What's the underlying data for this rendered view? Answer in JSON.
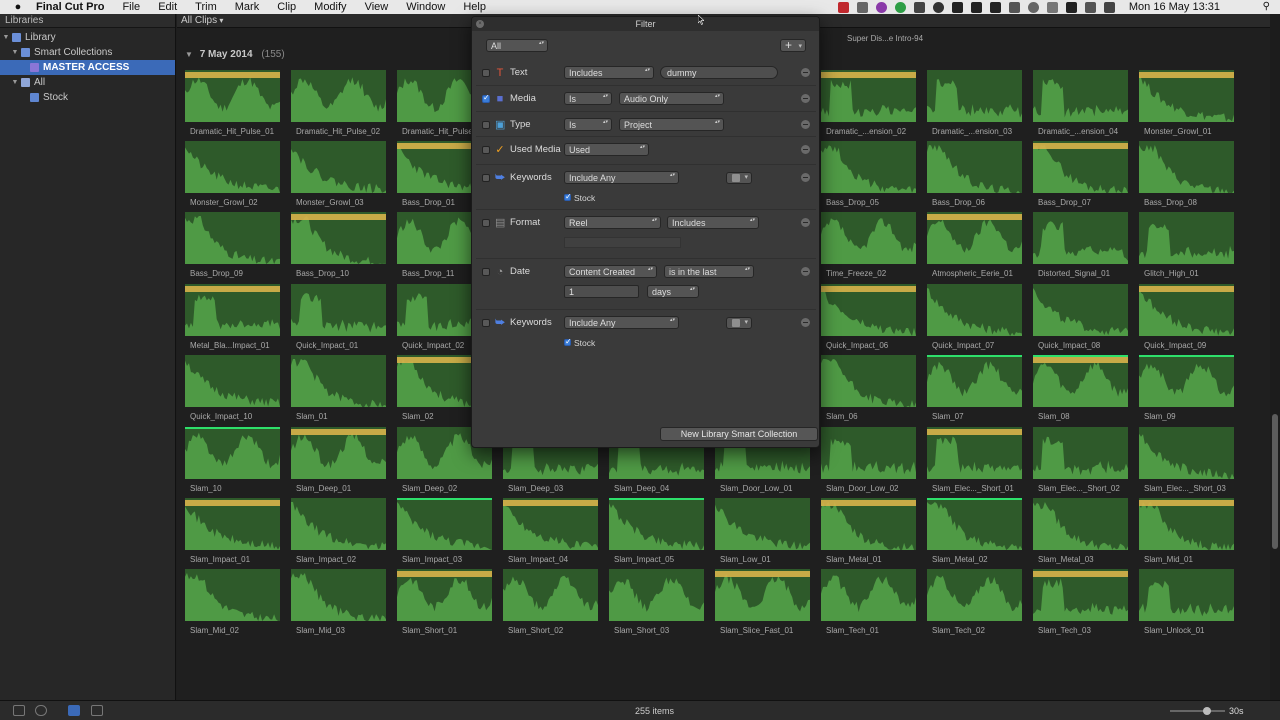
{
  "menubar": {
    "apple": "",
    "app_name": "Final Cut Pro",
    "menus": [
      "File",
      "Edit",
      "Trim",
      "Mark",
      "Clip",
      "Modify",
      "View",
      "Window",
      "Help"
    ],
    "clock": "Mon 16 May  13:31"
  },
  "sidebar": {
    "header": "Libraries",
    "items": [
      {
        "label": "Library",
        "indent": 0,
        "icon": "library-icon",
        "expanded": true
      },
      {
        "label": "Smart Collections",
        "indent": 1,
        "icon": "folder-icon",
        "expanded": true
      },
      {
        "label": "MASTER ACCESS",
        "indent": 2,
        "icon": "smart-collection-icon",
        "selected": true
      },
      {
        "label": "All",
        "indent": 1,
        "icon": "event-icon",
        "expanded": true
      },
      {
        "label": "Stock",
        "indent": 2,
        "icon": "keyword-icon"
      }
    ]
  },
  "browser": {
    "filter_popup": "All Clips",
    "top_clip_label": "Super Dis...e Intro-94",
    "date_header": "7 May 2014",
    "date_count": "(155)",
    "items_count": "255 items",
    "duration": "30s",
    "clips": [
      [
        "Dramatic_Hit_Pulse_01",
        "Dramatic_Hit_Pulse_02",
        "Dramatic_Hit_Pulse",
        "",
        "",
        "",
        "Dramatic_...ension_02",
        "Dramatic_...ension_03",
        "Dramatic_...ension_04",
        "Monster_Growl_01"
      ],
      [
        "Monster_Growl_02",
        "Monster_Growl_03",
        "Bass_Drop_01",
        "",
        "",
        "",
        "Bass_Drop_05",
        "Bass_Drop_06",
        "Bass_Drop_07",
        "Bass_Drop_08"
      ],
      [
        "Bass_Drop_09",
        "Bass_Drop_10",
        "Bass_Drop_11",
        "",
        "",
        "",
        "Time_Freeze_02",
        "Atmospheric_Eerie_01",
        "Distorted_Signal_01",
        "Glitch_High_01"
      ],
      [
        "Metal_Bla...Impact_01",
        "Quick_Impact_01",
        "Quick_Impact_02",
        "",
        "",
        "",
        "Quick_Impact_06",
        "Quick_Impact_07",
        "Quick_Impact_08",
        "Quick_Impact_09"
      ],
      [
        "Quick_Impact_10",
        "Slam_01",
        "Slam_02",
        "",
        "",
        "",
        "Slam_06",
        "Slam_07",
        "Slam_08",
        "Slam_09"
      ],
      [
        "Slam_10",
        "Slam_Deep_01",
        "Slam_Deep_02",
        "Slam_Deep_03",
        "Slam_Deep_04",
        "Slam_Door_Low_01",
        "Slam_Door_Low_02",
        "Slam_Elec..._Short_01",
        "Slam_Elec..._Short_02",
        "Slam_Elec..._Short_03"
      ],
      [
        "Slam_Impact_01",
        "Slam_Impact_02",
        "Slam_Impact_03",
        "Slam_Impact_04",
        "Slam_Impact_05",
        "Slam_Low_01",
        "Slam_Metal_01",
        "Slam_Metal_02",
        "Slam_Metal_03",
        "Slam_Mid_01"
      ],
      [
        "Slam_Mid_02",
        "Slam_Mid_03",
        "Slam_Short_01",
        "Slam_Short_02",
        "Slam_Short_03",
        "Slam_Slice_Fast_01",
        "Slam_Tech_01",
        "Slam_Tech_02",
        "Slam_Tech_03",
        "Slam_Unlock_01"
      ]
    ]
  },
  "filter": {
    "title": "Filter",
    "match_popup": "All",
    "add_button": "+",
    "rows": [
      {
        "label": "Text",
        "checked": false,
        "icon": "text-icon",
        "op": "Includes",
        "value": "dummy"
      },
      {
        "label": "Media",
        "checked": true,
        "icon": "media-icon",
        "op": "Is",
        "value": "Audio Only"
      },
      {
        "label": "Type",
        "checked": false,
        "icon": "type-icon",
        "op": "Is",
        "value": "Project"
      },
      {
        "label": "Used Media",
        "checked": false,
        "icon": "used-media-icon",
        "op": "Used"
      },
      {
        "label": "Keywords",
        "checked": false,
        "icon": "keyword-icon",
        "op": "Include Any",
        "sub": "Stock",
        "sub_checked": true
      },
      {
        "label": "Format",
        "checked": false,
        "icon": "format-icon",
        "op": "Reel",
        "value": "Includes"
      },
      {
        "label": "Date",
        "checked": false,
        "icon": "date-icon",
        "op": "Content Created",
        "value": "is in the last",
        "num": "1",
        "unit": "days"
      },
      {
        "label": "Keywords",
        "checked": false,
        "icon": "keyword-icon",
        "op": "Include Any",
        "sub": "Stock",
        "sub_checked": true
      }
    ],
    "new_library_button": "New Library Smart Collection"
  }
}
